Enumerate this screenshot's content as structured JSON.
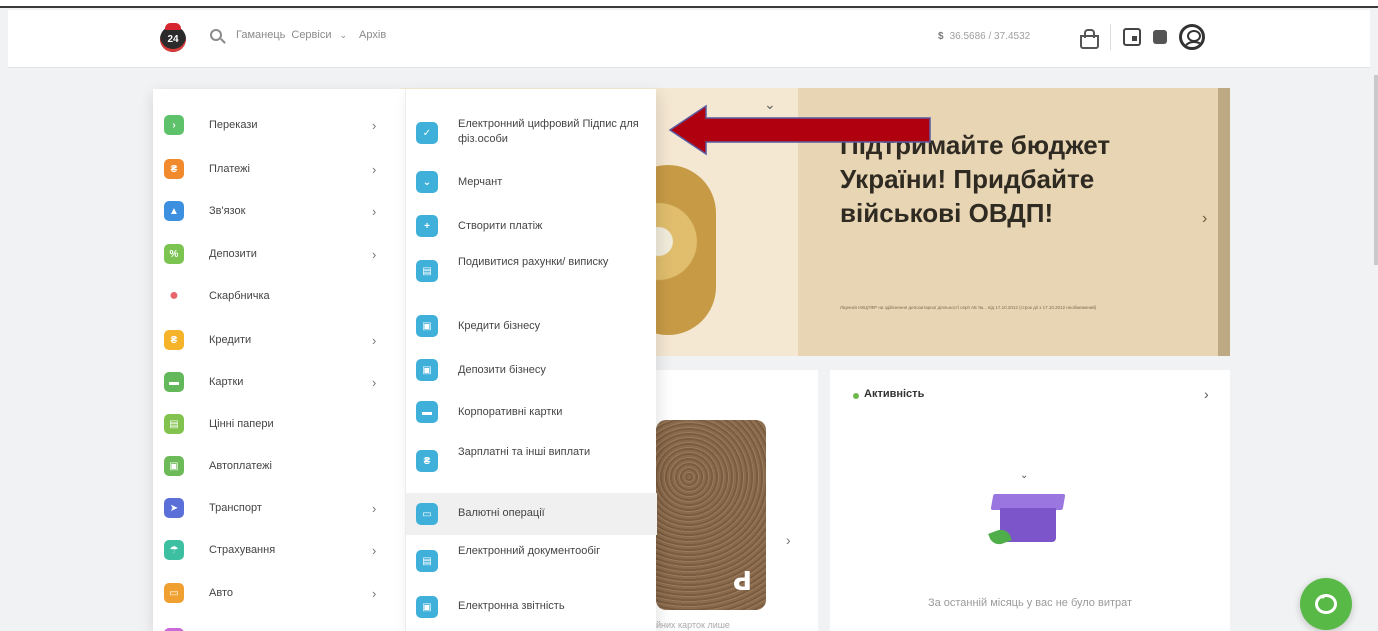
{
  "header": {
    "logo_text": "24",
    "nav": [
      "Гаманець",
      "Сервіси",
      "Архів"
    ],
    "rate_symbol": "$",
    "rate_value": "36.5686 / 37.4532"
  },
  "menu_left": [
    {
      "label": "Перекази",
      "color": "#5ec26a",
      "arrow": true
    },
    {
      "label": "Платежі",
      "color": "#f08a2c",
      "arrow": true
    },
    {
      "label": "Зв'язок",
      "color": "#3d8fe0",
      "arrow": true
    },
    {
      "label": "Депозити",
      "color": "#7cc452",
      "arrow": true
    },
    {
      "label": "Скарбничка",
      "color": "#e8646a",
      "arrow": false
    },
    {
      "label": "Кредити",
      "color": "#f5b32a",
      "arrow": true
    },
    {
      "label": "Картки",
      "color": "#62b85a",
      "arrow": true
    },
    {
      "label": "Цінні папери",
      "color": "#82c24e",
      "arrow": false
    },
    {
      "label": "Автоплатежі",
      "color": "#6dbb58",
      "arrow": false
    },
    {
      "label": "Транспорт",
      "color": "#5a6fd8",
      "arrow": true
    },
    {
      "label": "Страхування",
      "color": "#3dc0a2",
      "arrow": true
    },
    {
      "label": "Авто",
      "color": "#f0a030",
      "arrow": true
    }
  ],
  "menu_right": [
    {
      "label": "Електронний цифровий Підпис для фіз.особи"
    },
    {
      "label": "Мерчант"
    },
    {
      "label": "Створити платіж"
    },
    {
      "label": "Подивитися рахунки/ виписку"
    },
    {
      "label": "Кредити бізнесу"
    },
    {
      "label": "Депозити бізнесу"
    },
    {
      "label": "Корпоративні картки"
    },
    {
      "label": "Зарплатні та інші виплати"
    },
    {
      "label": "Валютні операції"
    },
    {
      "label": "Електронний документообіг"
    },
    {
      "label": "Електронна звітність"
    }
  ],
  "banner": {
    "title": "Підтримайте бюджет України! Придбайте військові ОВДП!",
    "small": "Ліцензія НКЦПФР на здійснення депозитарної діяльності серії АЕ №... від 17.10.2012 (строк дії з 17.10.2012 необмежений)"
  },
  "activity": {
    "title": "Активність",
    "empty_text": "За останній місяць у вас не було витрат"
  },
  "promo": {
    "caption": "йних карток лише"
  },
  "colors": {
    "accent_green": "#59b947",
    "annotation_red": "#b00010",
    "business_icon": "#3fb0d9"
  }
}
